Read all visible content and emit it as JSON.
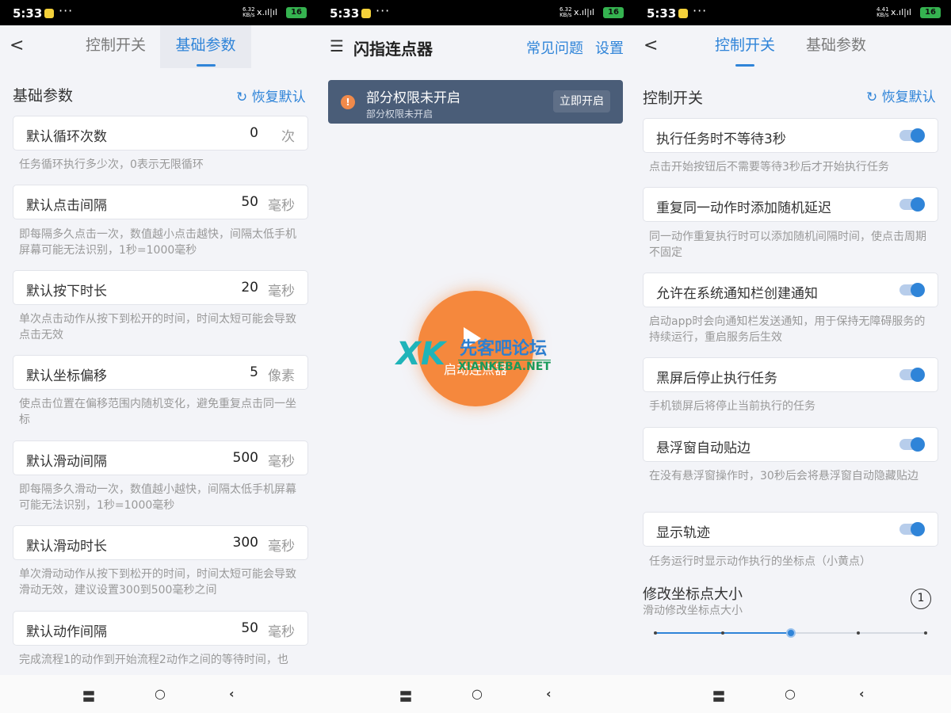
{
  "status": {
    "time": "5:33",
    "more": "···",
    "speed_a_top": "6.32",
    "speed_a_bot": "KB/s",
    "speed_c_top": "4.41",
    "speed_c_bot": "KB/s",
    "signal": "ⅹ.ıl|ıl",
    "battery": "16"
  },
  "screen1": {
    "back": "<",
    "tabs": [
      "控制开关",
      "基础参数"
    ],
    "active_tab": 1,
    "section_title": "基础参数",
    "restore": "恢复默认",
    "items": [
      {
        "label": "默认循环次数",
        "value": "0",
        "unit": "次",
        "desc": "任务循环执行多少次，0表示无限循环"
      },
      {
        "label": "默认点击间隔",
        "value": "50",
        "unit": "毫秒",
        "desc": "即每隔多久点击一次，数值越小点击越快，间隔太低手机屏幕可能无法识别，1秒=1000毫秒"
      },
      {
        "label": "默认按下时长",
        "value": "20",
        "unit": "毫秒",
        "desc": "单次点击动作从按下到松开的时间，时间太短可能会导致点击无效"
      },
      {
        "label": "默认坐标偏移",
        "value": "5",
        "unit": "像素",
        "desc": "使点击位置在偏移范围内随机变化，避免重复点击同一坐标"
      },
      {
        "label": "默认滑动间隔",
        "value": "500",
        "unit": "毫秒",
        "desc": "即每隔多久滑动一次，数值越小越快，间隔太低手机屏幕可能无法识别，1秒=1000毫秒"
      },
      {
        "label": "默认滑动时长",
        "value": "300",
        "unit": "毫秒",
        "desc": "单次滑动动作从按下到松开的时间，时间太短可能会导致滑动无效，建议设置300到500毫秒之间"
      },
      {
        "label": "默认动作间隔",
        "value": "50",
        "unit": "毫秒",
        "desc": "完成流程1的动作到开始流程2动作之间的等待时间，也"
      }
    ]
  },
  "screen2": {
    "menu": "☰",
    "title": "闪指连点器",
    "faq": "常见问题",
    "settings": "设置",
    "perm_title": "部分权限未开启",
    "perm_sub": "部分权限未开启",
    "perm_button": "立即开启",
    "start_label": "启动连点器",
    "watermark_logo": "XK",
    "watermark_cn": "先客吧论坛",
    "watermark_en": "XIANKEBA.NET"
  },
  "screen3": {
    "back": "<",
    "tabs": [
      "控制开关",
      "基础参数"
    ],
    "active_tab": 0,
    "section_title": "控制开关",
    "restore": "恢复默认",
    "toggles": [
      {
        "label": "执行任务时不等待3秒",
        "on": true,
        "desc": "点击开始按钮后不需要等待3秒后才开始执行任务"
      },
      {
        "label": "重复同一动作时添加随机延迟",
        "on": true,
        "desc": "同一动作重复执行时可以添加随机间隔时间，使点击周期不固定"
      },
      {
        "label": "允许在系统通知栏创建通知",
        "on": true,
        "desc": "启动app时会向通知栏发送通知，用于保持无障碍服务的持续运行，重启服务后生效"
      },
      {
        "label": "黑屏后停止执行任务",
        "on": true,
        "desc": "手机锁屏后将停止当前执行的任务"
      },
      {
        "label": "悬浮窗自动贴边",
        "on": true,
        "desc": "在没有悬浮窗操作时，30秒后会将悬浮窗自动隐藏贴边"
      },
      {
        "label": "显示轨迹",
        "on": true,
        "desc": "任务运行时显示动作执行的坐标点（小黄点）"
      }
    ],
    "size_title": "修改坐标点大小",
    "size_sub": "滑动修改坐标点大小",
    "size_value": "1",
    "size_steps": 5,
    "size_index": 2
  },
  "nav": {
    "recent": "〓",
    "home": "○",
    "back": "‹"
  },
  "colors": {
    "accent": "#2f84d8",
    "start_button": "#f5883d",
    "banner": "#4a5d78"
  }
}
